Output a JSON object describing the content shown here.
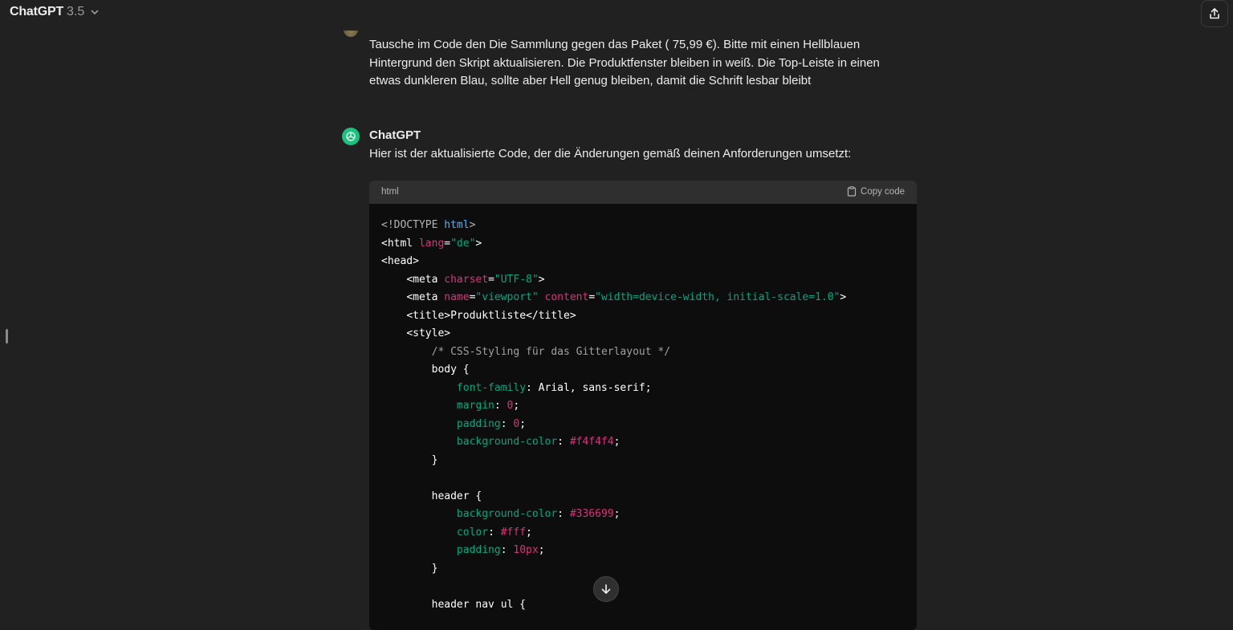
{
  "header": {
    "model_name": "ChatGPT",
    "model_version": "3.5"
  },
  "user_message": "Tausche im Code den Die Sammlung gegen das Paket ( 75,99 €). Bitte mit einen Hellblauen Hintergrund den Skript aktualisieren. Die Produktfenster bleiben in weiß. Die Top-Leiste in einen etwas dunkleren Blau, sollte aber Hell genug bleiben, damit die Schrift lesbar bleibt",
  "assistant": {
    "name": "ChatGPT",
    "intro": "Hier ist der aktualisierte Code, der die Änderungen gemäß deinen Anforderungen umsetzt:"
  },
  "code": {
    "language": "html",
    "copy_label": "Copy code",
    "lines": [
      [
        [
          "t-doctype",
          "<!DOCTYPE "
        ],
        [
          "t-kw",
          "html"
        ],
        [
          "t-doctype",
          ">"
        ]
      ],
      [
        [
          "t-tag",
          "<html "
        ],
        [
          "t-attr",
          "lang"
        ],
        [
          "t-plain",
          "="
        ],
        [
          "t-str",
          "\"de\""
        ],
        [
          "t-tag",
          ">"
        ]
      ],
      [
        [
          "t-tag",
          "<head>"
        ]
      ],
      [
        [
          "t-plain",
          "    "
        ],
        [
          "t-tag",
          "<meta "
        ],
        [
          "t-attr",
          "charset"
        ],
        [
          "t-plain",
          "="
        ],
        [
          "t-str",
          "\"UTF-8\""
        ],
        [
          "t-tag",
          ">"
        ]
      ],
      [
        [
          "t-plain",
          "    "
        ],
        [
          "t-tag",
          "<meta "
        ],
        [
          "t-attr",
          "name"
        ],
        [
          "t-plain",
          "="
        ],
        [
          "t-str",
          "\"viewport\""
        ],
        [
          "t-plain",
          " "
        ],
        [
          "t-attr",
          "content"
        ],
        [
          "t-plain",
          "="
        ],
        [
          "t-str",
          "\"width=device-width, initial-scale=1.0\""
        ],
        [
          "t-tag",
          ">"
        ]
      ],
      [
        [
          "t-plain",
          "    "
        ],
        [
          "t-tag",
          "<title>"
        ],
        [
          "t-plain",
          "Produktliste"
        ],
        [
          "t-tag",
          "</title>"
        ]
      ],
      [
        [
          "t-plain",
          "    "
        ],
        [
          "t-tag",
          "<style>"
        ]
      ],
      [
        [
          "t-plain",
          "        "
        ],
        [
          "t-comment",
          "/* CSS-Styling für das Gitterlayout */"
        ]
      ],
      [
        [
          "t-plain",
          "        body {"
        ]
      ],
      [
        [
          "t-plain",
          "            "
        ],
        [
          "t-prop",
          "font-family"
        ],
        [
          "t-plain",
          ": Arial, sans-serif;"
        ]
      ],
      [
        [
          "t-plain",
          "            "
        ],
        [
          "t-prop",
          "margin"
        ],
        [
          "t-plain",
          ": "
        ],
        [
          "t-num",
          "0"
        ],
        [
          "t-plain",
          ";"
        ]
      ],
      [
        [
          "t-plain",
          "            "
        ],
        [
          "t-prop",
          "padding"
        ],
        [
          "t-plain",
          ": "
        ],
        [
          "t-num",
          "0"
        ],
        [
          "t-plain",
          ";"
        ]
      ],
      [
        [
          "t-plain",
          "            "
        ],
        [
          "t-prop",
          "background-color"
        ],
        [
          "t-plain",
          ": "
        ],
        [
          "t-num",
          "#f4f4f4"
        ],
        [
          "t-plain",
          ";"
        ]
      ],
      [
        [
          "t-plain",
          "        }"
        ]
      ],
      [
        [
          "t-plain",
          ""
        ]
      ],
      [
        [
          "t-plain",
          "        header {"
        ]
      ],
      [
        [
          "t-plain",
          "            "
        ],
        [
          "t-prop",
          "background-color"
        ],
        [
          "t-plain",
          ": "
        ],
        [
          "t-num",
          "#336699"
        ],
        [
          "t-plain",
          ";"
        ]
      ],
      [
        [
          "t-plain",
          "            "
        ],
        [
          "t-prop",
          "color"
        ],
        [
          "t-plain",
          ": "
        ],
        [
          "t-num",
          "#fff"
        ],
        [
          "t-plain",
          ";"
        ]
      ],
      [
        [
          "t-plain",
          "            "
        ],
        [
          "t-prop",
          "padding"
        ],
        [
          "t-plain",
          ": "
        ],
        [
          "t-num",
          "10px"
        ],
        [
          "t-plain",
          ";"
        ]
      ],
      [
        [
          "t-plain",
          "        }"
        ]
      ],
      [
        [
          "t-plain",
          ""
        ]
      ],
      [
        [
          "t-plain",
          "        header nav ul {"
        ]
      ]
    ]
  }
}
